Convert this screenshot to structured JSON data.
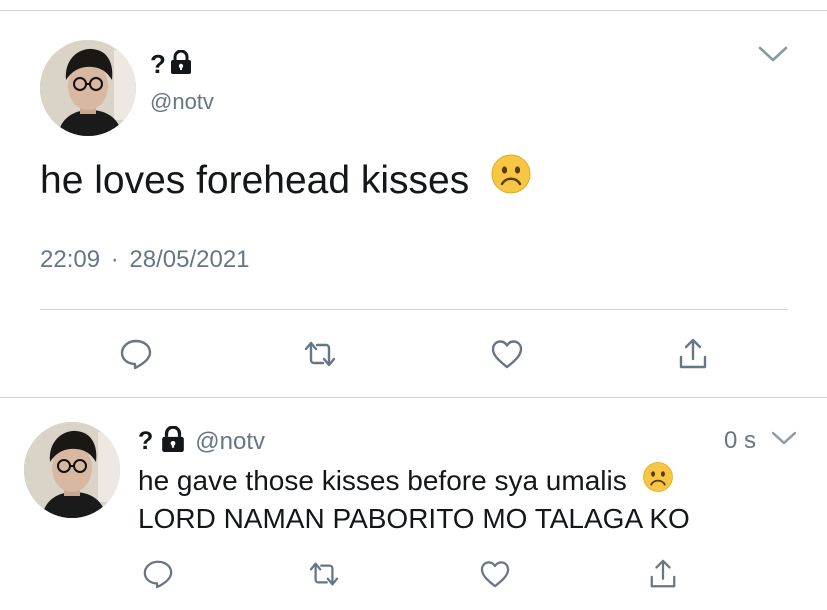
{
  "main_tweet": {
    "display_name": "?",
    "handle": "@notv",
    "text": "he loves forehead kisses",
    "emoji": "sad-face-emoji",
    "time": "22:09",
    "separator": "·",
    "date": "28/05/2021"
  },
  "reply_tweet": {
    "display_name": "?",
    "handle": "@notv",
    "timestamp": "0 s",
    "text_line1": "he gave those kisses before sya umalis",
    "emoji": "sad-face-emoji",
    "text_line2": "LORD NAMAN PABORITO MO TALAGA KO"
  },
  "icons": {
    "reply": "reply-icon",
    "retweet": "retweet-icon",
    "like": "heart-icon",
    "share": "share-icon",
    "lock": "lock-icon",
    "chevron": "chevron-down-icon"
  },
  "colors": {
    "text": "#14171a",
    "secondary": "#657786",
    "icon": "#657786",
    "divider": "#cdd3d8",
    "emoji": "#f7c744"
  }
}
